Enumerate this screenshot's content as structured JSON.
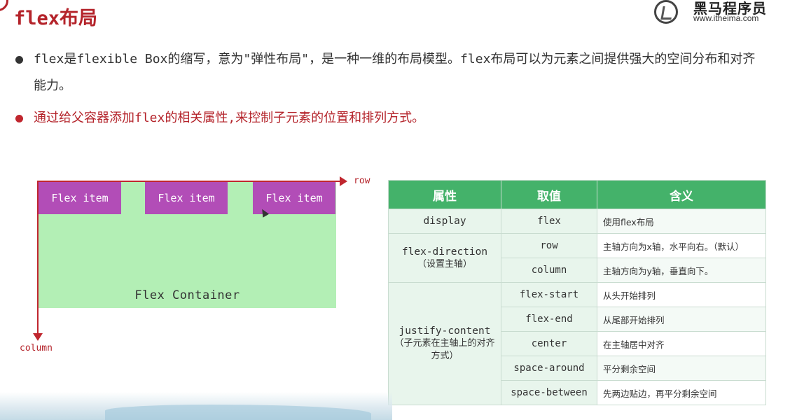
{
  "title": "flex布局",
  "logo": {
    "name_cn": "黑马程序员",
    "url": "www.itheima.com"
  },
  "bullets": [
    "flex是flexible Box的缩写，意为\"弹性布局\"，是一种一维的布局模型。flex布局可以为元素之间提供强大的空间分布和对齐能力。",
    "通过给父容器添加flex的相关属性,来控制子元素的位置和排列方式。"
  ],
  "diagram": {
    "items": [
      "Flex item",
      "Flex item",
      "Flex item"
    ],
    "container_label": "Flex Container",
    "row_label": "row",
    "column_label": "column"
  },
  "table": {
    "headers": [
      "属性",
      "取值",
      "含义"
    ],
    "display": {
      "prop": "display",
      "val": "flex",
      "desc": "使用flex布局"
    },
    "direction": {
      "prop": "flex-direction",
      "prop_sub": "（设置主轴）",
      "rows": [
        {
          "val": "row",
          "desc": "主轴方向为x轴，水平向右。（默认）"
        },
        {
          "val": "column",
          "desc": "主轴方向为y轴，垂直向下。"
        }
      ]
    },
    "justify": {
      "prop": "justify-content",
      "prop_sub": "（子元素在主轴上的对齐方式）",
      "rows": [
        {
          "val": "flex-start",
          "desc": "从头开始排列"
        },
        {
          "val": "flex-end",
          "desc": "从尾部开始排列"
        },
        {
          "val": "center",
          "desc": "在主轴居中对齐"
        },
        {
          "val": "space-around",
          "desc": "平分剩余空间"
        },
        {
          "val": "space-between",
          "desc": "先两边贴边，再平分剩余空间"
        }
      ]
    }
  },
  "colors": {
    "accent_red": "#b4232a",
    "header_green": "#44b26a",
    "item_purple": "#b24db7",
    "container_green": "#b3efb5"
  }
}
